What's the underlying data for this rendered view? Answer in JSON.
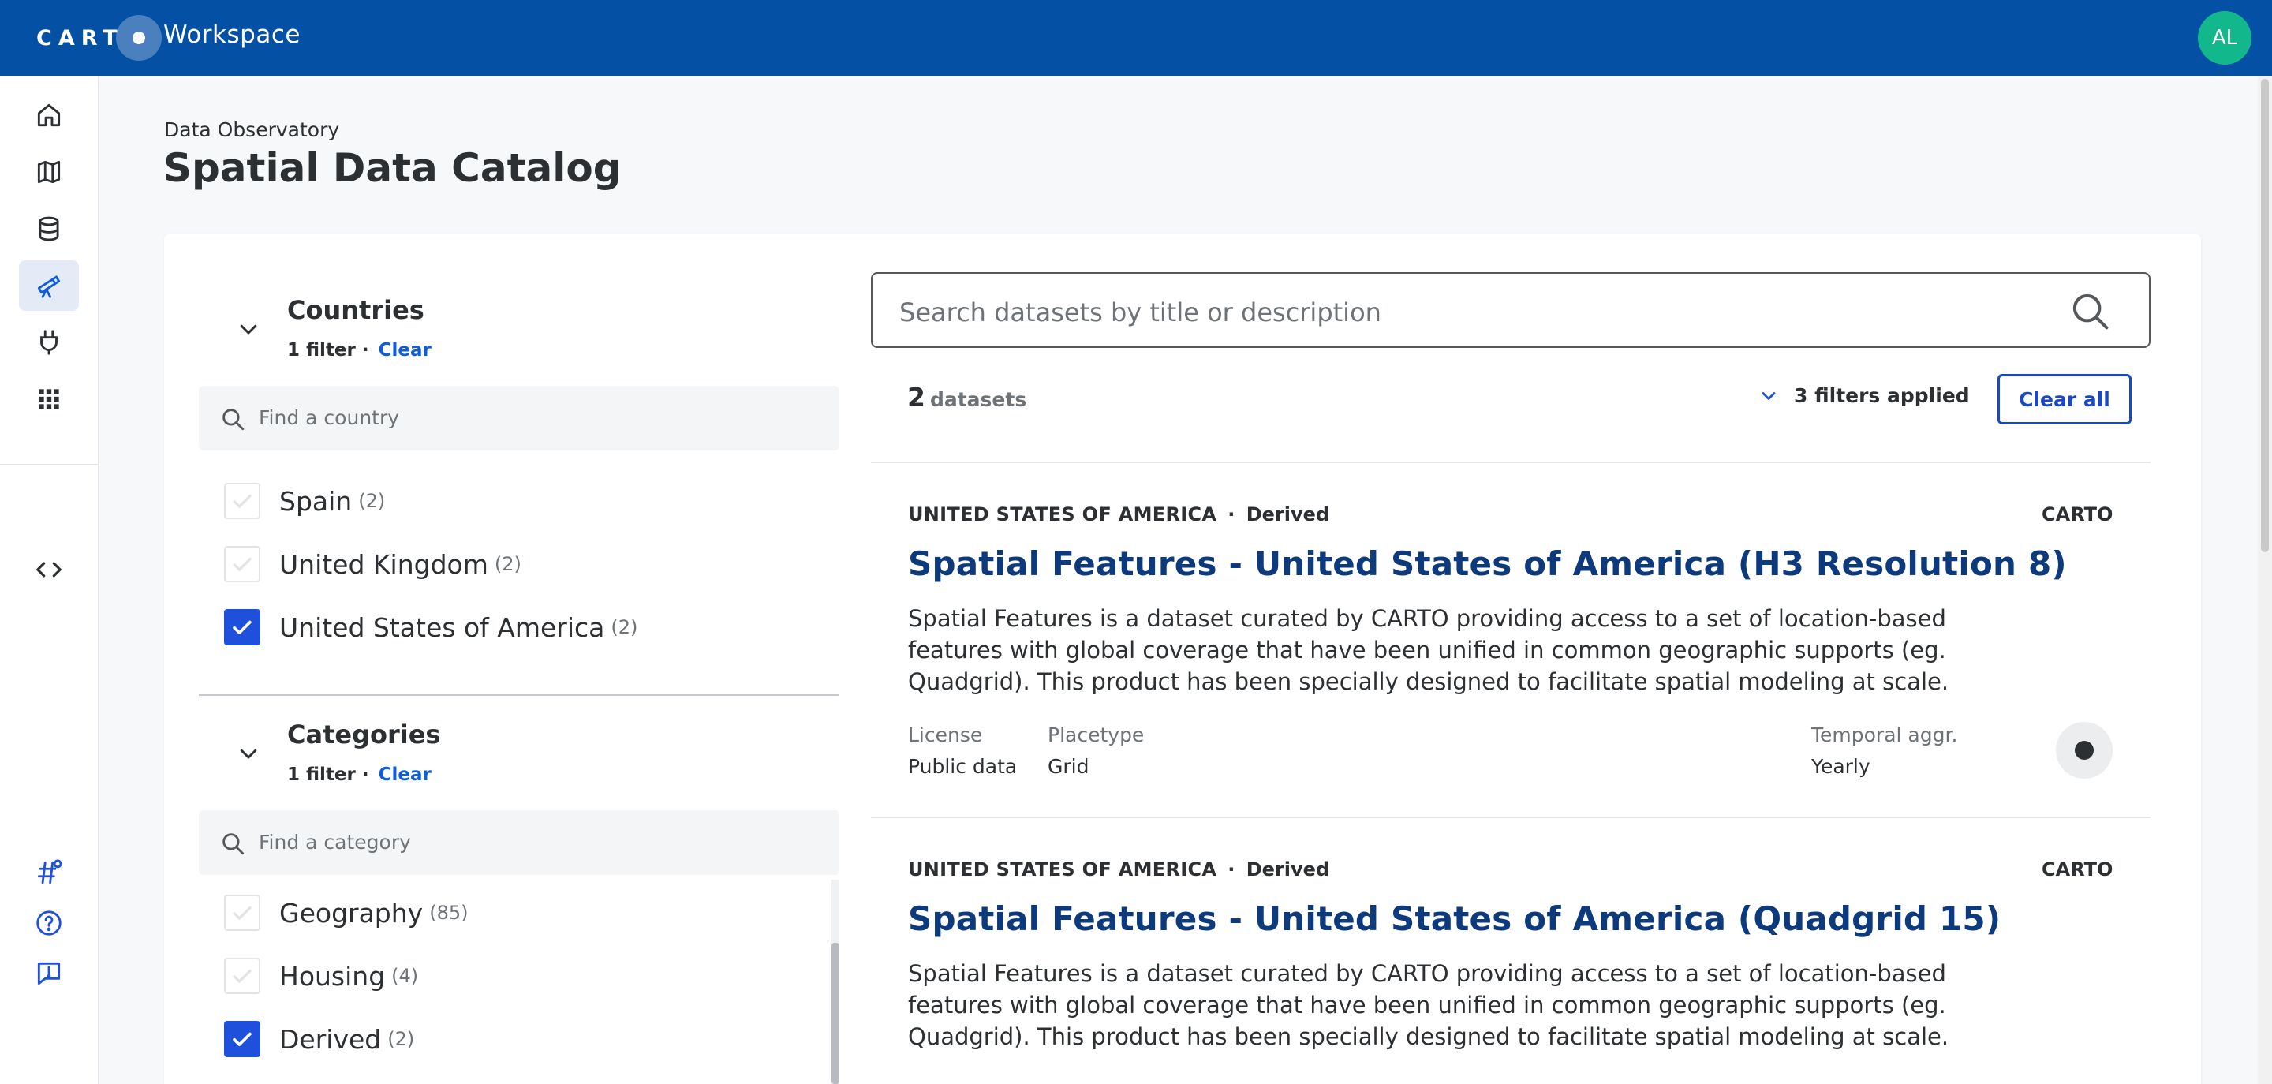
{
  "topbar": {
    "logo_text": "CART",
    "app_name": "Workspace",
    "avatar_initials": "AL",
    "bg_color": "#0450a4"
  },
  "sidebar": {
    "items": [
      {
        "name": "home-icon",
        "active": false
      },
      {
        "name": "maps-icon",
        "active": false
      },
      {
        "name": "data-explorer-icon",
        "active": false
      },
      {
        "name": "data-observatory-icon",
        "active": true
      },
      {
        "name": "connections-icon",
        "active": false
      },
      {
        "name": "applications-icon",
        "active": false
      },
      {
        "name": "developers-icon",
        "active": false
      }
    ],
    "bottom_items": [
      {
        "name": "whats-new-icon"
      },
      {
        "name": "help-icon"
      },
      {
        "name": "feedback-icon"
      }
    ]
  },
  "header": {
    "breadcrumb": "Data Observatory",
    "title": "Spatial Data Catalog"
  },
  "filters": {
    "countries": {
      "title": "Countries",
      "filter_count": "1 filter ·",
      "clear_label": "Clear",
      "find_placeholder": "Find a country",
      "options": [
        {
          "label": "Spain",
          "count": "(2)",
          "checked": false
        },
        {
          "label": "United Kingdom",
          "count": "(2)",
          "checked": false
        },
        {
          "label": "United States of America",
          "count": "(2)",
          "checked": true
        }
      ]
    },
    "categories": {
      "title": "Categories",
      "filter_count": "1 filter ·",
      "clear_label": "Clear",
      "find_placeholder": "Find a category",
      "options": [
        {
          "label": "Geography",
          "count": "(85)",
          "checked": false
        },
        {
          "label": "Housing",
          "count": "(4)",
          "checked": false
        },
        {
          "label": "Derived",
          "count": "(2)",
          "checked": true
        }
      ]
    }
  },
  "search": {
    "placeholder": "Search datasets by title or description"
  },
  "results": {
    "count": "2",
    "count_unit": "datasets",
    "filters_applied": "3 filters applied",
    "clear_all_label": "Clear all",
    "datasets": [
      {
        "country": "UNITED STATES OF AMERICA",
        "kind": "Derived",
        "provider": "CARTO",
        "title": "Spatial Features - United States of America (H3 Resolution 8)",
        "description": "Spatial Features is a dataset curated by CARTO providing access to a set of location-based features with global coverage that have been unified in common geographic supports (eg. Quadgrid). This product has been specially designed to facilitate spatial modeling at scale. Spatial Features includes…",
        "license_label": "License",
        "license_value": "Public data",
        "placetype_label": "Placetype",
        "placetype_value": "Grid",
        "temporal_label": "Temporal aggr.",
        "temporal_value": "Yearly"
      },
      {
        "country": "UNITED STATES OF AMERICA",
        "kind": "Derived",
        "provider": "CARTO",
        "title": "Spatial Features - United States of America (Quadgrid 15)",
        "description": "Spatial Features is a dataset curated by CARTO providing access to a set of location-based features with global coverage that have been unified in common geographic supports (eg. Quadgrid). This product has been specially designed to facilitate spatial modeling at scale. Spatial Features includes…"
      }
    ]
  },
  "colors": {
    "accent": "#1e50db",
    "title_blue": "#0d3a7d",
    "avatar": "#13b78c"
  }
}
